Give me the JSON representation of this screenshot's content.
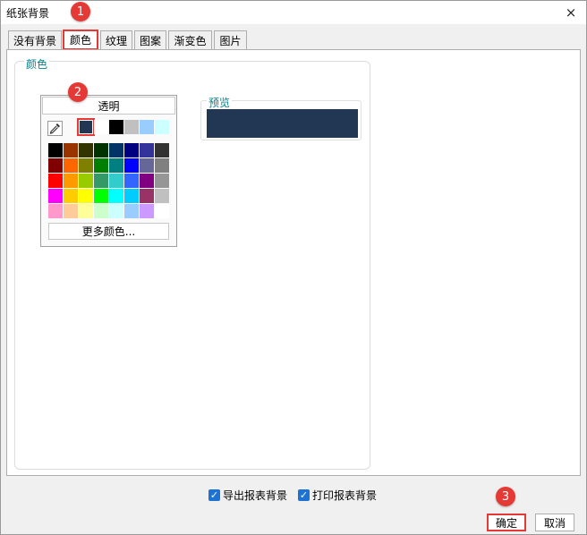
{
  "window": {
    "title": "纸张背景",
    "close_icon": "×"
  },
  "tabs": [
    {
      "label": "没有背景"
    },
    {
      "label": "颜色"
    },
    {
      "label": "纹理"
    },
    {
      "label": "图案"
    },
    {
      "label": "渐变色"
    },
    {
      "label": "图片"
    }
  ],
  "color_group": {
    "label": "颜色"
  },
  "picker": {
    "transparent_label": "透明",
    "more_colors_label": "更多颜色...",
    "recent_colors": [
      "#223754",
      "#ffffff",
      "#000000",
      "#c0c0c0",
      "#99ccff",
      "#ccffff"
    ],
    "grid_colors": [
      "#000000",
      "#993300",
      "#333300",
      "#003300",
      "#003366",
      "#000080",
      "#333399",
      "#333333",
      "#800000",
      "#ff6600",
      "#808000",
      "#008000",
      "#008080",
      "#0000ff",
      "#666699",
      "#808080",
      "#ff0000",
      "#ff9900",
      "#99cc00",
      "#339966",
      "#33cccc",
      "#3366ff",
      "#800080",
      "#969696",
      "#ff00ff",
      "#ffcc00",
      "#ffff00",
      "#00ff00",
      "#00ffff",
      "#00ccff",
      "#993366",
      "#c0c0c0",
      "#ff99cc",
      "#ffcc99",
      "#ffff99",
      "#ccffcc",
      "#ccffff",
      "#99ccff",
      "#cc99ff",
      "#ffffff"
    ]
  },
  "preview": {
    "label": "预览",
    "color": "#223754"
  },
  "callouts": {
    "one": "1",
    "two": "2",
    "three": "3"
  },
  "options": {
    "export_label": "导出报表背景",
    "export_checked": true,
    "print_label": "打印报表背景",
    "print_checked": true
  },
  "buttons": {
    "ok_label": "确定",
    "cancel_label": "取消"
  },
  "accent_color": "#e53935",
  "label_color": "#00838f"
}
